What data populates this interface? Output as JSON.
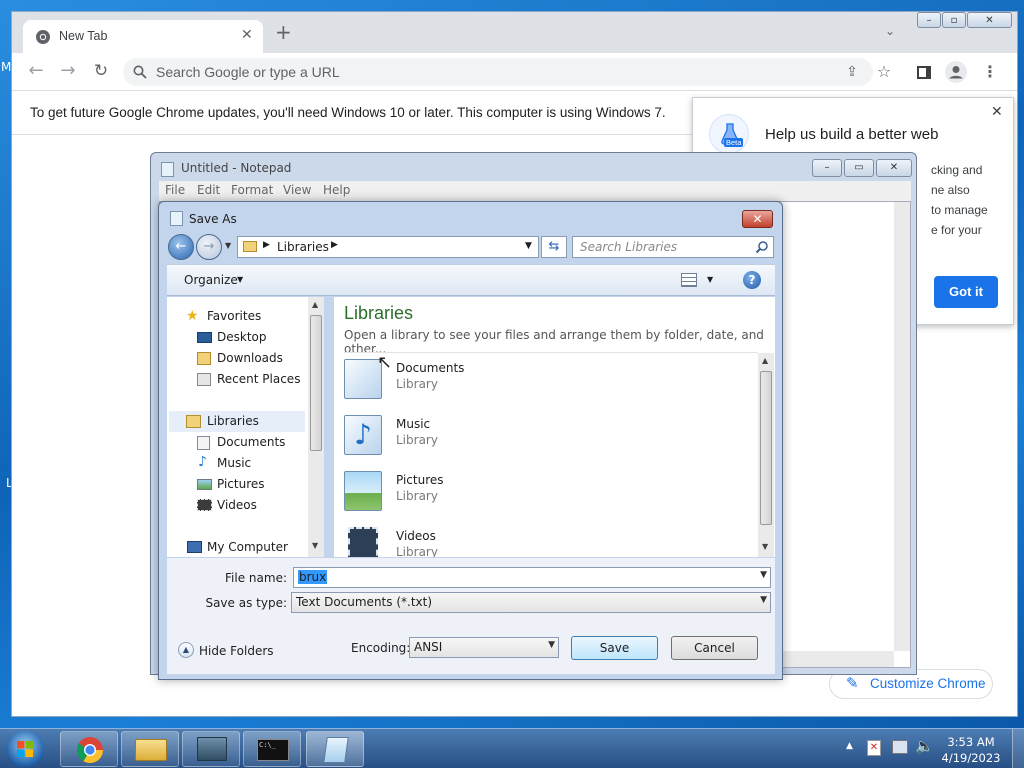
{
  "desktop": {
    "edge_letter_top": "M",
    "edge_letter_mid": "L"
  },
  "chrome": {
    "tab_title": "New Tab",
    "omnibox_placeholder": "Search Google or type a URL",
    "info_message": "To get future Google Chrome updates, you'll need Windows 10 or later. This computer is using Windows 7.",
    "promo": {
      "badge": "Beta",
      "title": "Help us build a better web",
      "body_lines": [
        "cking and",
        "ne also",
        "to manage",
        "e for your"
      ],
      "button": "Got it"
    },
    "customize_label": "Customize Chrome"
  },
  "notepad": {
    "title": "Untitled - Notepad",
    "menu": [
      "File",
      "Edit",
      "Format",
      "View",
      "Help"
    ]
  },
  "save_as": {
    "title": "Save As",
    "breadcrumb": "Libraries",
    "search_placeholder": "Search Libraries",
    "organize": "Organize",
    "nav": {
      "favorites": "Favorites",
      "favorites_items": [
        "Desktop",
        "Downloads",
        "Recent Places"
      ],
      "libraries": "Libraries",
      "library_items": [
        "Documents",
        "Music",
        "Pictures",
        "Videos"
      ],
      "computer": "My Computer"
    },
    "content_heading": "Libraries",
    "content_sub": "Open a library to see your files and arrange them by folder, date, and other...",
    "libraries": [
      {
        "name": "Documents",
        "type": "Library"
      },
      {
        "name": "Music",
        "type": "Library"
      },
      {
        "name": "Pictures",
        "type": "Library"
      },
      {
        "name": "Videos",
        "type": "Library"
      }
    ],
    "file_name_label": "File name:",
    "file_name_value": "brux",
    "save_type_label": "Save as type:",
    "save_type_value": "Text Documents (*.txt)",
    "hide_folders": "Hide Folders",
    "encoding_label": "Encoding:",
    "encoding_value": "ANSI",
    "save_button": "Save",
    "cancel_button": "Cancel"
  },
  "taskbar": {
    "time": "3:53 AM",
    "date": "4/19/2023"
  }
}
